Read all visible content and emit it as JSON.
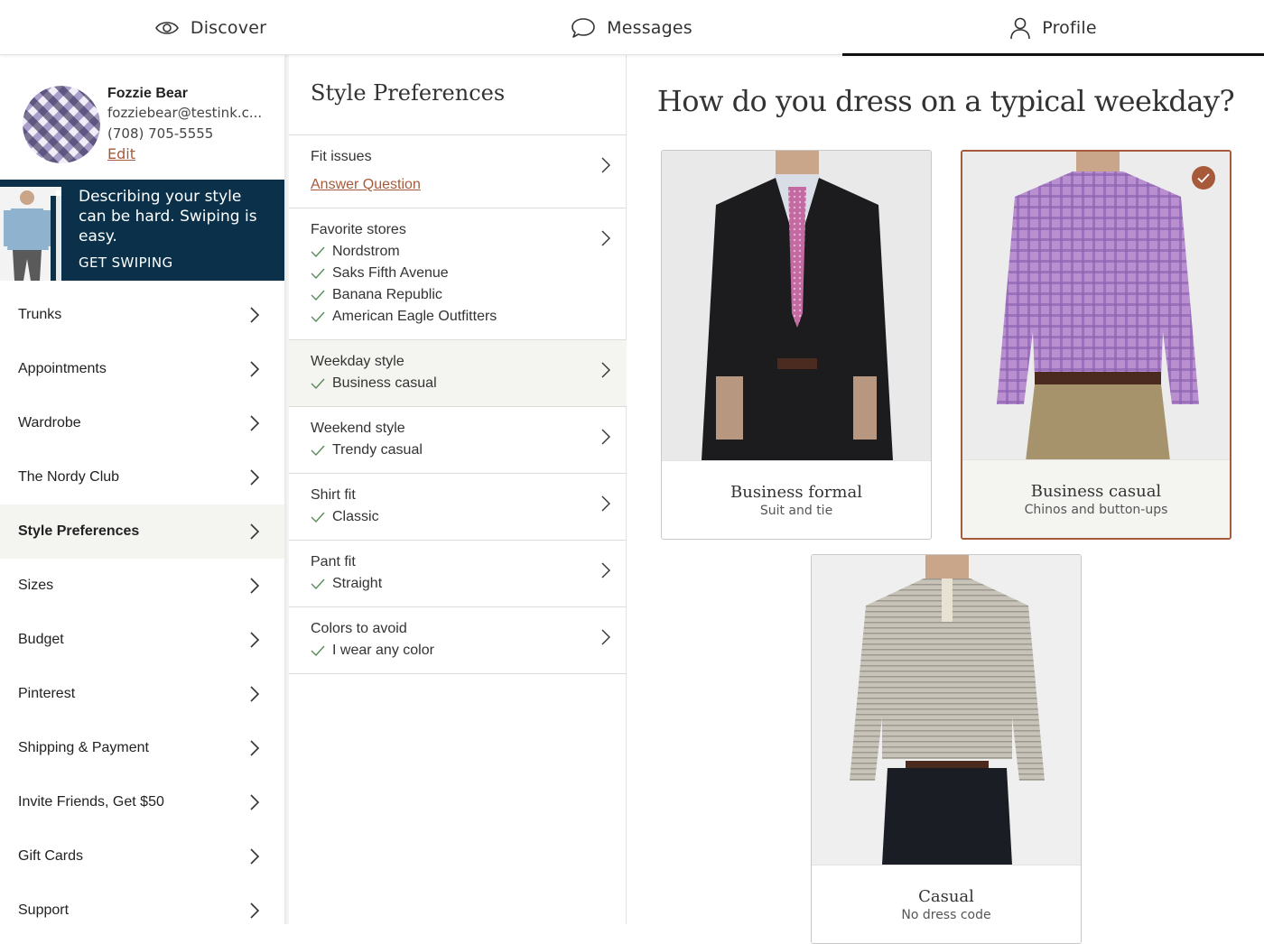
{
  "topnav": {
    "tabs": [
      {
        "label": "Discover",
        "icon": "eye-icon"
      },
      {
        "label": "Messages",
        "icon": "chat-bubble-icon"
      },
      {
        "label": "Profile",
        "icon": "person-icon"
      }
    ],
    "active_tab": "Profile"
  },
  "profile": {
    "name": "Fozzie Bear",
    "email": "fozziebear@testink.c...",
    "phone": "(708) 705-5555",
    "edit_label": "Edit"
  },
  "promo": {
    "text": "Describing your style can be hard. Swiping is easy.",
    "cta": "GET SWIPING"
  },
  "sidebar": {
    "items": [
      {
        "label": "Trunks"
      },
      {
        "label": "Appointments"
      },
      {
        "label": "Wardrobe"
      },
      {
        "label": "The Nordy Club"
      },
      {
        "label": "Style Preferences",
        "active": true
      },
      {
        "label": "Sizes"
      },
      {
        "label": "Budget"
      },
      {
        "label": "Pinterest"
      },
      {
        "label": "Shipping & Payment"
      },
      {
        "label": "Invite Friends, Get $50"
      },
      {
        "label": "Gift Cards"
      },
      {
        "label": "Support"
      }
    ]
  },
  "preferences": {
    "title": "Style Preferences",
    "items": [
      {
        "label": "Fit issues",
        "link": "Answer Question"
      },
      {
        "label": "Favorite stores",
        "values": [
          "Nordstrom",
          "Saks Fifth Avenue",
          "Banana Republic",
          "American Eagle Outfitters"
        ]
      },
      {
        "label": "Weekday style",
        "values": [
          "Business casual"
        ],
        "active": true
      },
      {
        "label": "Weekend style",
        "values": [
          "Trendy casual"
        ]
      },
      {
        "label": "Shirt fit",
        "values": [
          "Classic"
        ]
      },
      {
        "label": "Pant fit",
        "values": [
          "Straight"
        ]
      },
      {
        "label": "Colors to avoid",
        "values": [
          "I wear any color"
        ]
      }
    ]
  },
  "question": {
    "title": "How do you dress on a typical weekday?",
    "options": [
      {
        "title": "Business formal",
        "subtitle": "Suit and tie",
        "selected": false
      },
      {
        "title": "Business casual",
        "subtitle": "Chinos and button-ups",
        "selected": true
      },
      {
        "title": "Casual",
        "subtitle": "No dress code",
        "selected": false
      }
    ]
  },
  "colors": {
    "accent": "#a75a3a",
    "promo_bg": "#0a3149",
    "active_bg": "#f4f4f1"
  }
}
